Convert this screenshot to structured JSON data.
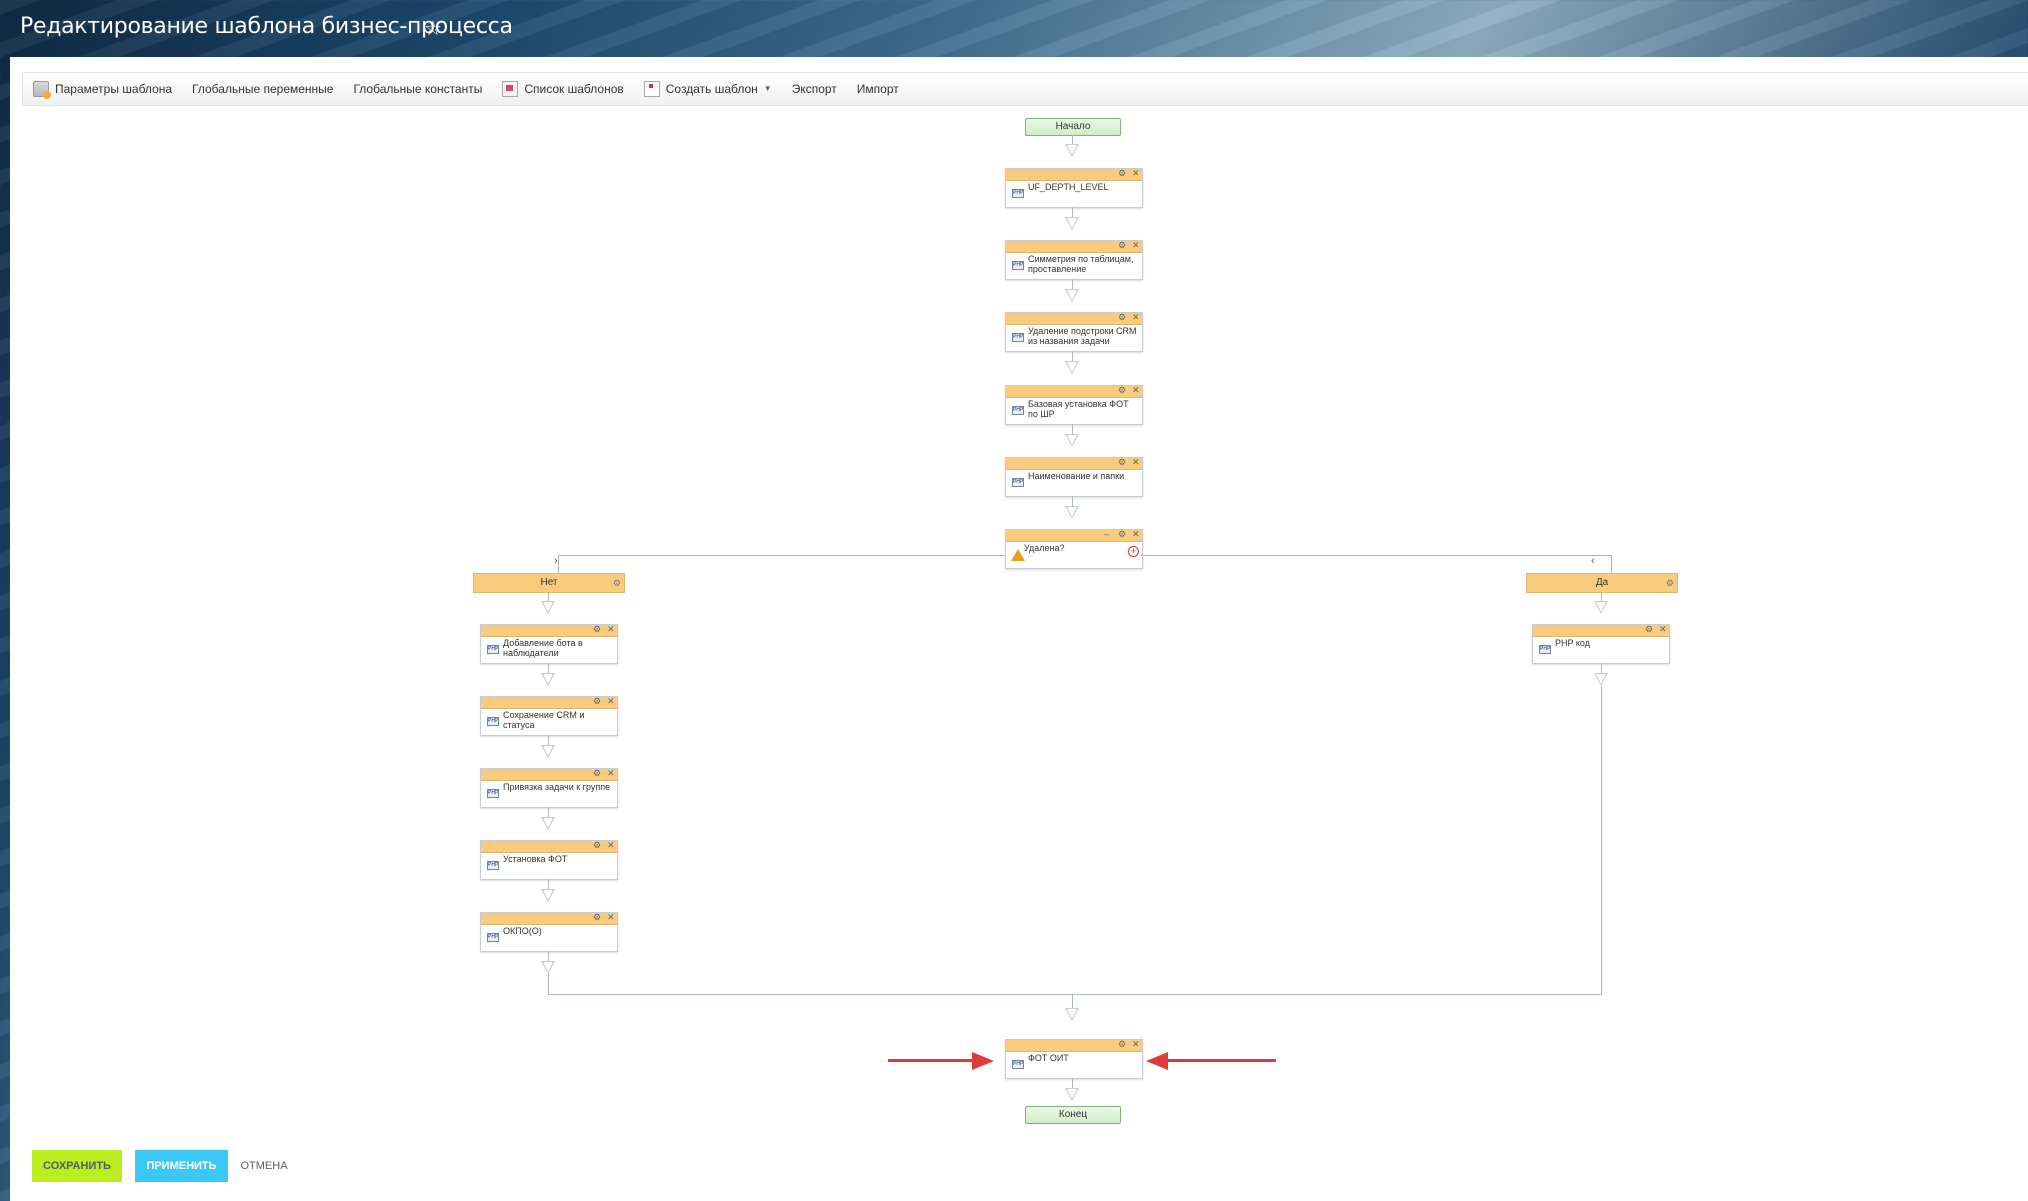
{
  "header": {
    "title": "Редактирование шаблона бизнес-процесса"
  },
  "toolbar": {
    "params": "Параметры шаблона",
    "global_vars": "Глобальные переменные",
    "global_consts": "Глобальные константы",
    "template_list": "Список шаблонов",
    "create_template": "Создать шаблон",
    "export": "Экспорт",
    "import": "Импорт"
  },
  "flow": {
    "start": "Начало",
    "end": "Конец",
    "steps": [
      "UF_DEPTH_LEVEL",
      "Симметрия по таблицам, проставление",
      "Удаление подстроки CRM из названия задачи",
      "Базовая установка ФОТ по ШР",
      "Наименование и папки"
    ],
    "condition": "Удалена?",
    "branch_no": {
      "label": "Нет",
      "steps": [
        "Добавление бота в наблюдатели",
        "Сохранение CRM и статуса",
        "Привязка задачи к группе",
        "Установка ФОТ",
        "ОКПО(О)"
      ]
    },
    "branch_yes": {
      "label": "Да",
      "steps": [
        "PHP код"
      ]
    },
    "final_step": "ФОТ ОИТ",
    "activity_icon_text": "PHP"
  },
  "footer": {
    "save": "Сохранить",
    "apply": "Применить",
    "cancel": "Отмена"
  },
  "colors": {
    "activity_header": "#f8cc7c",
    "terminal": "#cdeec6",
    "save_button": "#bbed21",
    "apply_button": "#3bc8f5",
    "annotation_arrow": "#e03a3a"
  }
}
